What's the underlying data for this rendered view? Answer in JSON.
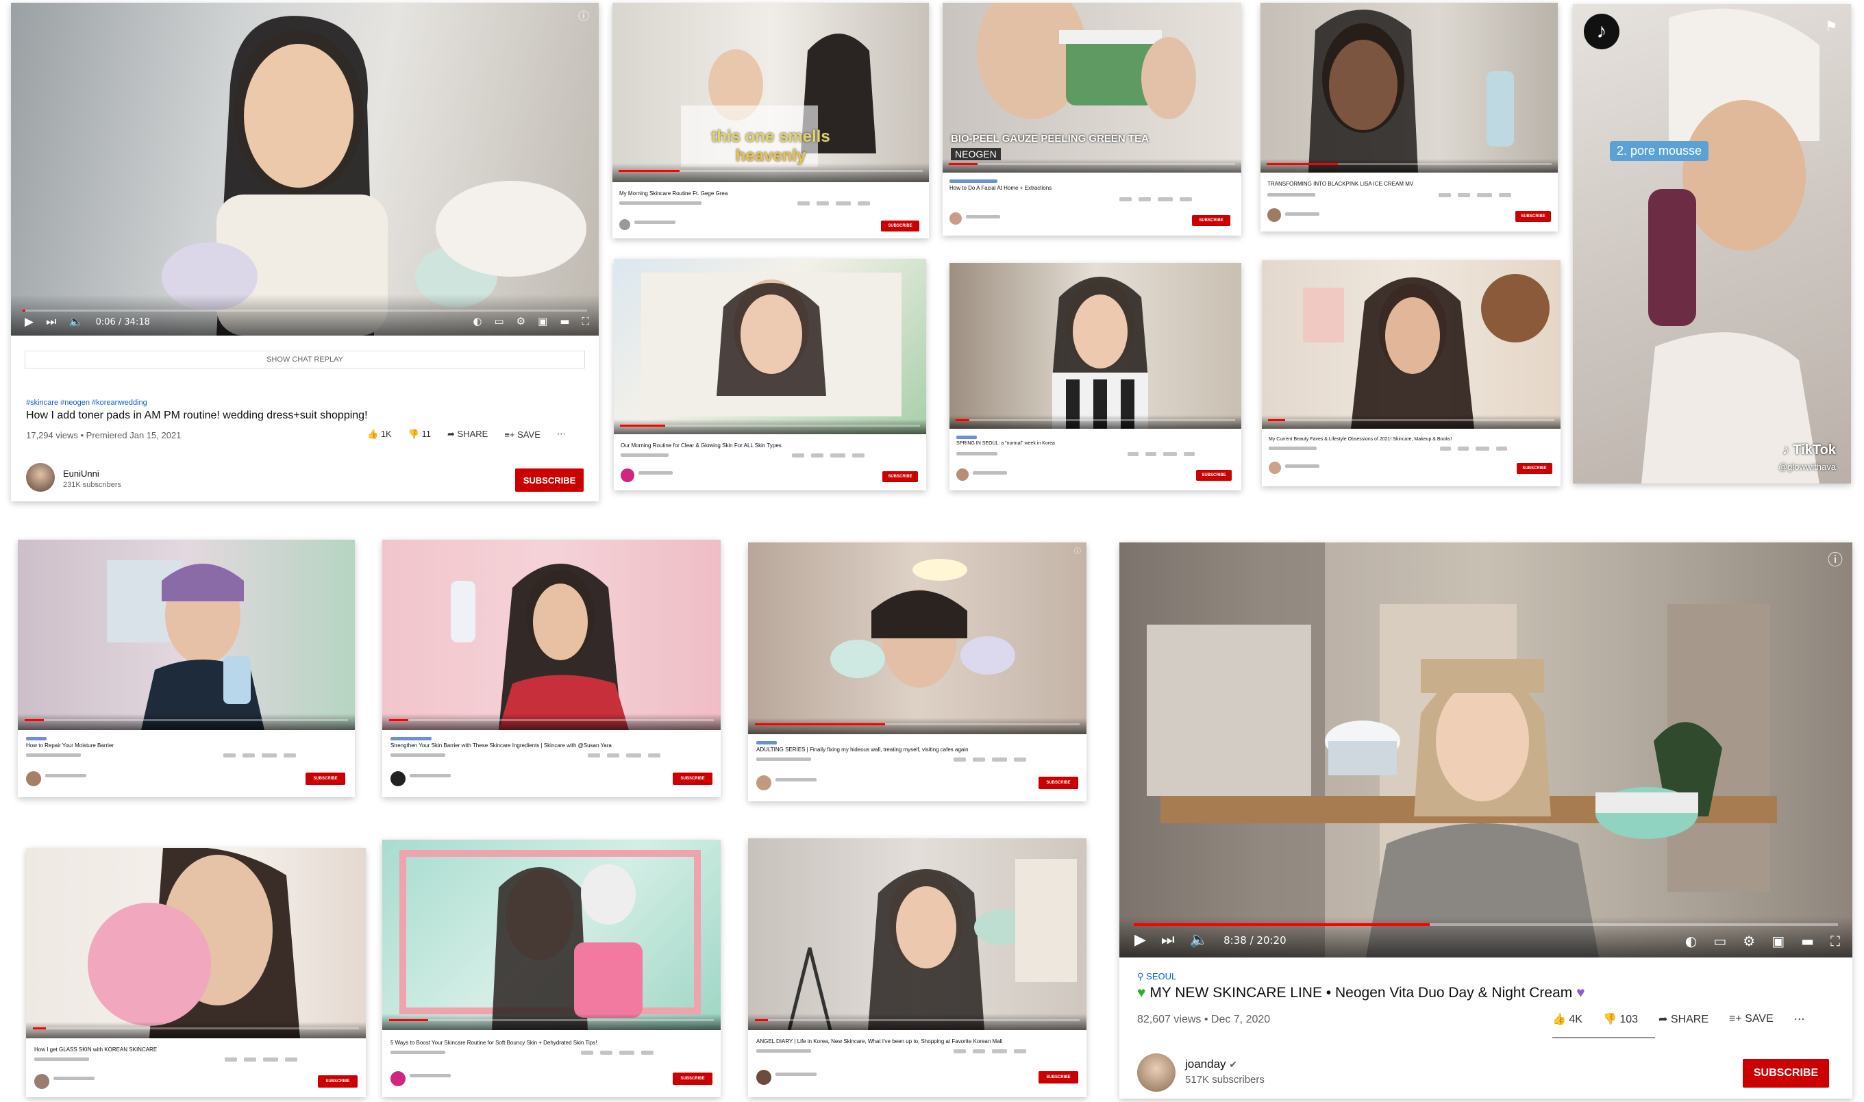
{
  "main_video": {
    "time": "0:06 / 34:18",
    "chat_replay": "SHOW CHAT REPLAY",
    "hashtags": "#skincare #neogen #koreanwedding",
    "title": "How I add toner pads in AM PM routine! wedding dress+suit shopping!",
    "meta": "17,294 views • Premiered Jan 15, 2021",
    "likes": "1K",
    "dislikes": "11",
    "share": "SHARE",
    "save": "SAVE",
    "channel": "EuniUnni",
    "subscribers": "231K subscribers",
    "subscribe": "SUBSCRIBE",
    "progress": 0.003
  },
  "featured_video": {
    "time": "8:38 / 20:20",
    "location": "SEOUL",
    "title": "MY NEW SKINCARE LINE • Neogen Vita Duo Day & Night Cream",
    "meta": "82,607 views • Dec 7, 2020",
    "likes": "4K",
    "dislikes": "103",
    "share": "SHARE",
    "save": "SAVE",
    "channel": "joanday",
    "subscribers": "517K subscribers",
    "subscribe": "SUBSCRIBE",
    "progress": 0.42
  },
  "tiktok": {
    "caption": "2. pore mousse",
    "brand": "TikTok",
    "handle": "@glowwithava"
  },
  "overlays": {
    "smells_line1": "this one smells",
    "smells_line2": "heavenly",
    "bio_peel": "BIO-PEEL GAUZE PEELING GREEN TEA",
    "neogen": "NEOGEN"
  },
  "small_cards": [
    {
      "title": "My Morning Skincare Routine Ft. Gege Grea",
      "subscribe": "SUBSCRIBE"
    },
    {
      "title": "How to Do A Facial At Home + Extractions",
      "subscribe": "SUBSCRIBE"
    },
    {
      "title": "TRANSFORMING INTO BLACKPINK LISA ICE CREAM MV",
      "subscribe": "SUBSCRIBE"
    },
    {
      "title": "Our Morning Routine for Clear & Glowing Skin For ALL Skin Types",
      "subscribe": "SUBSCRIBE"
    },
    {
      "title": "SPRING IN SEOUL: a \"normal\" week in Korea",
      "subscribe": "SUBSCRIBE"
    },
    {
      "title": "My Current Beauty Faves & Lifestyle Obsessions of 2021! Skincare, Makeup & Books!",
      "subscribe": "SUBSCRIBE"
    },
    {
      "title": "How to Repair Your Moisture Barrier",
      "subscribe": "SUBSCRIBE"
    },
    {
      "title": "Strengthen Your Skin Barrier with These Skincare Ingredients | Skincare with @Susan Yara",
      "subscribe": "SUBSCRIBE"
    },
    {
      "title": "ADULTING SERIES | Finally fixing my hideous wall, treating myself, visiting cafes again",
      "subscribe": "SUBSCRIBE"
    },
    {
      "title": "How I get GLASS SKIN with KOREAN SKINCARE",
      "subscribe": "SUBSCRIBE"
    },
    {
      "title": "5 Ways to Boost Your Skincare Routine for Soft Bouncy Skin + Dehydrated Skin Tips!",
      "subscribe": "SUBSCRIBE"
    },
    {
      "title": "ANGEL DIARY | Life in Korea, New Skincare, What I've been up to, Shopping at Favorite Korean Mall",
      "subscribe": "SUBSCRIBE"
    }
  ],
  "colors": {
    "red": "#cc0000",
    "progress": "#ff0000",
    "tag": "#065fd4"
  }
}
